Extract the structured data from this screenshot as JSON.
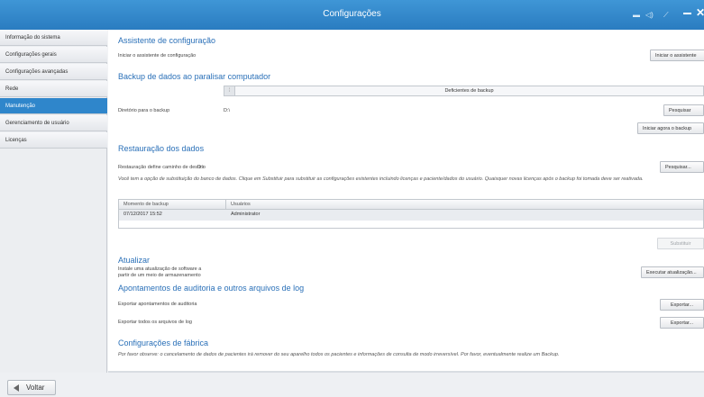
{
  "window": {
    "title": "Configurações"
  },
  "sidebar": {
    "items": [
      {
        "label": "Informação do sistema"
      },
      {
        "label": "Configurações gerais"
      },
      {
        "label": "Configurações avançadas"
      },
      {
        "label": "Rede"
      },
      {
        "label": "Manutenção",
        "active": true
      },
      {
        "label": "Gerenciamento de usuário"
      },
      {
        "label": "Licenças"
      }
    ]
  },
  "assistant": {
    "heading": "Assistente de configuração",
    "text": "Iniciar o assistente de configuração",
    "button": "Iniciar o assistente"
  },
  "backup": {
    "heading": "Backup de dados ao paralisar computador",
    "selector": "Deficientes de backup",
    "dir_label": "Diretório para o backup",
    "dir_value": "D:\\",
    "browse_button": "Pesquisar",
    "now_button": "Iniciar agora o backup"
  },
  "restore": {
    "heading": "Restauração dos dados",
    "path_label": "Restauração define caminho de destino",
    "path_value": "D:\\",
    "browse_button": "Pesquisar...",
    "note": "Você tem a opção de substituição do banco de dados. Clique em Substituir para substituir as configurações existentes incluindo licenças e paciente/dados do usuário. Quaisquer novas licenças após o backup foi tomada deve ser reativada.",
    "table": {
      "columns": [
        "Momento de backup",
        "Usuários"
      ],
      "rows": [
        [
          "07/12/2017 15:52",
          "Administrator"
        ]
      ]
    },
    "replace_button": "Substituir"
  },
  "update": {
    "heading": "Atualizar",
    "text_line1": "Instale uma atualização de software a",
    "text_line2": "partir de um meio de armazenamento",
    "button": "Executar atualização..."
  },
  "logs": {
    "heading": "Apontamentos de auditoria e outros arquivos de log",
    "audit_label": "Exportar apontamentos de auditoria",
    "audit_button": "Exportar...",
    "all_label": "Exportar todos os arquivos de log",
    "all_button": "Exportar..."
  },
  "factory": {
    "heading": "Configurações de fábrica",
    "note": "Por favor observe: o cancelamento de dados de pacientes irá remover do seu aparelho todos os pacientes e informações de consulta de modo irreversível. Por favor, eventualmente realize um Backup."
  },
  "footer": {
    "back_button": "Voltar"
  },
  "colors": {
    "titlebar": "#2f86cb",
    "accent": "#2a70b8",
    "active_sidebar": "#2f86cb"
  },
  "titlebar_icons": [
    "display-icon",
    "volume-icon",
    "network-icon",
    "minimize-icon",
    "close-icon"
  ]
}
